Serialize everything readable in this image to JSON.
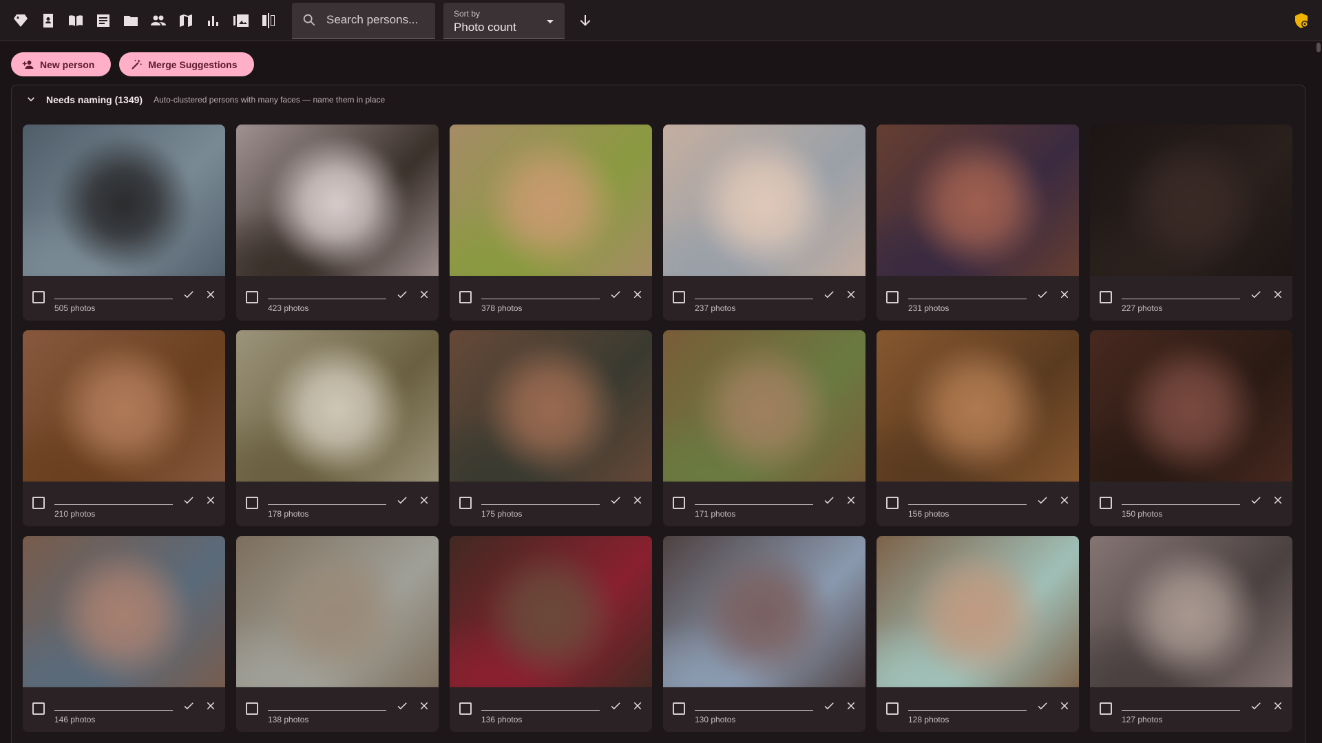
{
  "toolbar": {
    "nav_icons": [
      "gem-icon",
      "contact-book-icon",
      "open-book-icon",
      "article-icon",
      "folder-icon",
      "people-icon",
      "map-icon",
      "bar-chart-icon",
      "photo-library-icon",
      "compare-icon"
    ],
    "search_placeholder": "Search persons...",
    "sort_label": "Sort by",
    "sort_value": "Photo count",
    "sort_direction_icon": "arrow-down-icon",
    "admin_icon": "admin-shield-icon"
  },
  "actions": {
    "new_person": "New person",
    "merge_suggestions": "Merge Suggestions"
  },
  "section": {
    "title": "Needs naming (1349)",
    "subtitle": "Auto-clustered persons with many faces — name them in place"
  },
  "persons": [
    {
      "count": "505 photos",
      "tones": [
        "#4c5a66",
        "#2a2a2c",
        "#7a8a95"
      ]
    },
    {
      "count": "423 photos",
      "tones": [
        "#a89a9a",
        "#d8cccc",
        "#3a302a"
      ]
    },
    {
      "count": "378 photos",
      "tones": [
        "#a88a6a",
        "#c89a70",
        "#8a9a40"
      ]
    },
    {
      "count": "237 photos",
      "tones": [
        "#c8b0a0",
        "#e0c8b8",
        "#9aa0a8"
      ]
    },
    {
      "count": "231 photos",
      "tones": [
        "#6a4030",
        "#a06050",
        "#3a2a40"
      ]
    },
    {
      "count": "227 photos",
      "tones": [
        "#1a1414",
        "#3a2a26",
        "#2a201c"
      ]
    },
    {
      "count": "210 photos",
      "tones": [
        "#8a5a40",
        "#b07a58",
        "#6a4020"
      ]
    },
    {
      "count": "178 photos",
      "tones": [
        "#a09880",
        "#d0c8b8",
        "#6a6040"
      ]
    },
    {
      "count": "175 photos",
      "tones": [
        "#6a4a38",
        "#9a6a50",
        "#3a3a30"
      ]
    },
    {
      "count": "171 photos",
      "tones": [
        "#7a5a38",
        "#a08060",
        "#6a7a40"
      ]
    },
    {
      "count": "156 photos",
      "tones": [
        "#8a5a30",
        "#b07a50",
        "#5a3a20"
      ]
    },
    {
      "count": "150 photos",
      "tones": [
        "#4a2a20",
        "#7a4a40",
        "#2a1a14"
      ]
    },
    {
      "count": "146 photos",
      "tones": [
        "#7a5a48",
        "#a88070",
        "#5a6a7a"
      ]
    },
    {
      "count": "138 photos",
      "tones": [
        "#7a6a58",
        "#9a8a78",
        "#a0a098"
      ]
    },
    {
      "count": "136 photos",
      "tones": [
        "#3a2a20",
        "#6a4a3a",
        "#8a2030"
      ]
    },
    {
      "count": "130 photos",
      "tones": [
        "#4a3a38",
        "#7a6060",
        "#8a9ab0"
      ]
    },
    {
      "count": "128 photos",
      "tones": [
        "#7a5a40",
        "#c09a80",
        "#a0c0b8"
      ]
    },
    {
      "count": "127 photos",
      "tones": [
        "#8a7a78",
        "#a89890",
        "#4a4040"
      ]
    }
  ]
}
